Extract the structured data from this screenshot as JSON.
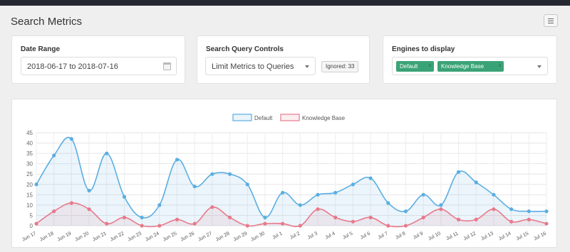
{
  "page": {
    "title": "Search Metrics"
  },
  "date_range": {
    "title": "Date Range",
    "value": "2018-06-17 to 2018-07-16"
  },
  "query_controls": {
    "title": "Search Query Controls",
    "selected": "Limit Metrics to Queries",
    "ignored_label": "Ignored: 33"
  },
  "engines": {
    "title": "Engines to display",
    "selected": [
      {
        "label": "Default",
        "remove": "x"
      },
      {
        "label": "Knowledge Base",
        "remove": "x"
      }
    ]
  },
  "icons": {
    "menu": "hamburger-icon",
    "calendar": "calendar-icon",
    "dropdown": "chevron-down-icon"
  },
  "colors": {
    "accent_green": "#3aa376",
    "default_series": "#5aaee2",
    "kb_series": "#e8798b",
    "topbar": "#252830"
  },
  "chart_data": {
    "type": "line",
    "title": "",
    "xlabel": "",
    "ylabel": "",
    "ylim": [
      0,
      45
    ],
    "yticks": [
      0,
      5,
      10,
      15,
      20,
      25,
      30,
      35,
      40,
      45
    ],
    "grid": true,
    "legend_position": "top-center",
    "categories": [
      "Jun 17",
      "Jun 18",
      "Jun 19",
      "Jun 20",
      "Jun 21",
      "Jun 22",
      "Jun 23",
      "Jun 24",
      "Jun 25",
      "Jun 26",
      "Jun 27",
      "Jun 28",
      "Jun 29",
      "Jun 30",
      "Jul 1",
      "Jul 2",
      "Jul 3",
      "Jul 4",
      "Jul 5",
      "Jul 6",
      "Jul 7",
      "Jul 8",
      "Jul 9",
      "Jul 10",
      "Jul 11",
      "Jul 12",
      "Jul 13",
      "Jul 14",
      "Jul 15",
      "Jul 16"
    ],
    "series": [
      {
        "name": "Default",
        "color": "#5aaee2",
        "fill": "rgba(90,174,226,0.12)",
        "values": [
          20,
          34,
          42,
          17,
          35,
          14,
          4,
          10,
          32,
          19,
          25,
          25,
          20,
          4,
          16,
          10,
          15,
          16,
          20,
          23,
          11,
          7,
          15,
          10,
          26,
          21,
          15,
          8,
          7,
          7
        ]
      },
      {
        "name": "Knowledge Base",
        "color": "#e8798b",
        "fill": "rgba(232,121,139,0.12)",
        "values": [
          1,
          7,
          11,
          8,
          1,
          4,
          0,
          0,
          3,
          1,
          9,
          4,
          0,
          1,
          1,
          0,
          8,
          4,
          2,
          4,
          0,
          0,
          4,
          8,
          3,
          3,
          8,
          2,
          3,
          1
        ]
      }
    ]
  }
}
